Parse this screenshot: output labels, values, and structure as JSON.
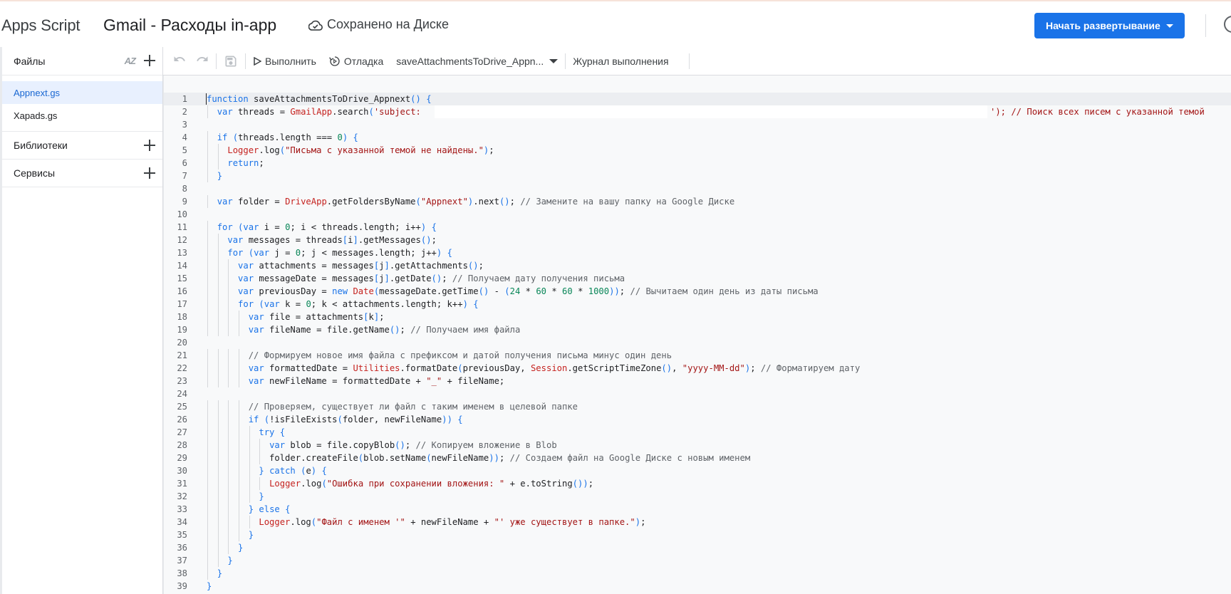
{
  "header": {
    "app_title": "Apps Script",
    "project_title": "Gmail - Расходы in-app",
    "save_status": "Сохранено на Диске",
    "deploy_label": "Начать развертывание"
  },
  "sidebar": {
    "files_label": "Файлы",
    "sort_icon": "AZ",
    "files": [
      "Appnext.gs",
      "Xapads.gs"
    ],
    "libraries_label": "Библиотеки",
    "services_label": "Сервисы"
  },
  "toolbar": {
    "run_label": "Выполнить",
    "debug_label": "Отладка",
    "function_select": "saveAttachmentsToDrive_Appn...",
    "log_label": "Журнал выполнения"
  },
  "editor": {
    "line_numbers": [
      "1",
      "2",
      "3",
      "4",
      "5",
      "6",
      "7",
      "8",
      "9",
      "10",
      "11",
      "12",
      "13",
      "14",
      "15",
      "16",
      "17",
      "18",
      "19",
      "20",
      "21",
      "22",
      "23",
      "24",
      "25",
      "26",
      "27",
      "28",
      "29",
      "30",
      "31",
      "32",
      "33",
      "34",
      "35",
      "36",
      "37",
      "38",
      "39"
    ],
    "line2_comment": "'); // Поиск всех писем с указанной темой",
    "lines": [
      "function saveAttachmentsToDrive_Appnext() {",
      "  var threads = GmailApp.search('subject:",
      "",
      "  if (threads.length === 0) {",
      "    Logger.log(\"Письма с указанной темой не найдены.\");",
      "    return;",
      "  }",
      "",
      "  var folder = DriveApp.getFoldersByName(\"Appnext\").next(); // Замените на вашу папку на Google Диске",
      "",
      "  for (var i = 0; i < threads.length; i++) {",
      "    var messages = threads[i].getMessages();",
      "    for (var j = 0; j < messages.length; j++) {",
      "      var attachments = messages[j].getAttachments();",
      "      var messageDate = messages[j].getDate(); // Получаем дату получения письма",
      "      var previousDay = new Date(messageDate.getTime() - (24 * 60 * 60 * 1000)); // Вычитаем один день из даты письма",
      "      for (var k = 0; k < attachments.length; k++) {",
      "        var file = attachments[k];",
      "        var fileName = file.getName(); // Получаем имя файла",
      "",
      "        // Формируем новое имя файла с префиксом и датой получения письма минус один день",
      "        var formattedDate = Utilities.formatDate(previousDay, Session.getScriptTimeZone(), \"yyyy-MM-dd\"); // Форматируем дату",
      "        var newFileName = formattedDate + \"_\" + fileName;",
      "",
      "        // Проверяем, существует ли файл с таким именем в целевой папке",
      "        if (!isFileExists(folder, newFileName)) {",
      "          try {",
      "            var blob = file.copyBlob(); // Копируем вложение в Blob",
      "            folder.createFile(blob.setName(newFileName)); // Создаем файл на Google Диске с новым именем",
      "          } catch (e) {",
      "            Logger.log(\"Ошибка при сохранении вложения: \" + e.toString());",
      "          }",
      "        } else {",
      "          Logger.log(\"Файл с именем '\" + newFileName + \"' уже существует в папке.\");",
      "        }",
      "      }",
      "    }",
      "  }",
      "}"
    ]
  },
  "colors": {
    "accent": "#1a73e8",
    "keyword": "#1a73e8",
    "string": "#a31515",
    "number": "#098658",
    "comment": "#5f6368",
    "class": "#c5221f"
  },
  "icons": [
    "cloud-saved-icon",
    "undo-icon",
    "redo-icon",
    "save-icon",
    "run-icon",
    "debug-icon",
    "caret-down-icon",
    "plus-icon",
    "sort-az-icon"
  ]
}
